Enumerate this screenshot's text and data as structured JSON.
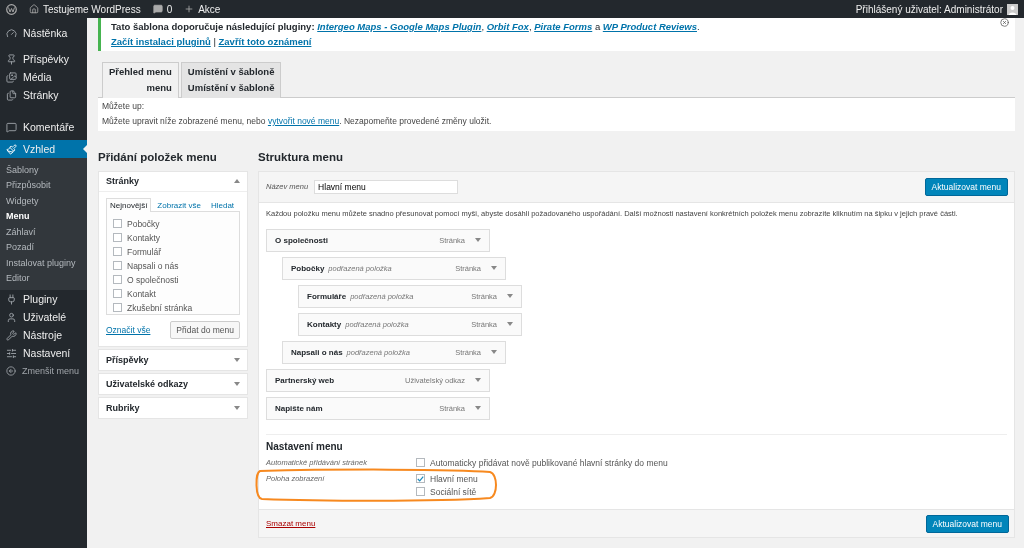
{
  "admin_bar": {
    "site": "Testujeme WordPress",
    "comments": "0",
    "new": "Akce",
    "account": "Přihlášený uživatel: Administrátor"
  },
  "sidebar": {
    "items": [
      {
        "label": "Nástěnka",
        "selected": false
      },
      {
        "label": "Příspěvky",
        "selected": false
      },
      {
        "label": "Média",
        "selected": false
      },
      {
        "label": "Stránky",
        "selected": false
      },
      {
        "label": "Komentáře",
        "selected": false
      },
      {
        "label": "Vzhled",
        "selected": true,
        "children": [
          {
            "label": "Šablony",
            "selected": false
          },
          {
            "label": "Přizpůsobit",
            "selected": false
          },
          {
            "label": "Widgety",
            "selected": false
          },
          {
            "label": "Menu",
            "selected": true
          },
          {
            "label": "Záhlaví",
            "selected": false
          },
          {
            "label": "Pozadí",
            "selected": false
          },
          {
            "label": "Instalovat pluginy",
            "selected": false
          },
          {
            "label": "Editor",
            "selected": false
          }
        ]
      },
      {
        "label": "Pluginy",
        "selected": false
      },
      {
        "label": "Uživatelé",
        "selected": false
      },
      {
        "label": "Nástroje",
        "selected": false
      },
      {
        "label": "Nastavení",
        "selected": false
      }
    ],
    "collapse": "Zmenšit menu"
  },
  "notice": {
    "text": "**Tato šablona doporučuje následující pluginy:**",
    "plugins": [
      {
        "name": "Intergeo Maps - Google Maps Plugin",
        "after": ", "
      },
      {
        "name": "Orbit Fox",
        "after": ", "
      },
      {
        "name": "Pirate Forms",
        "after": " a "
      },
      {
        "name": "WP Product Reviews",
        "after": "."
      }
    ],
    "links": [
      "Začít instalaci pluginů",
      "Zavřít toto oznámení"
    ],
    "separator": "|"
  },
  "tabs": [
    {
      "lines": [
        "Přehled menu",
        "menu"
      ],
      "selected": true
    },
    {
      "lines": [
        "Umístění v šabloně",
        "Umístění v šabloně"
      ],
      "selected": false
    }
  ],
  "info": {
    "ghost": "Můžete up:",
    "before": "Můžete upravit níže zobrazené menu, nebo",
    "link": "vytvořit nové menu",
    "after": ". Nezapomeňte provedené změny uložit."
  },
  "add_items": {
    "title": "Přidání položek menu",
    "sections": [
      {
        "title": "Stránky",
        "expanded": true,
        "tabs": [
          {
            "label": "Nejnovější",
            "selected": true
          },
          {
            "label": "Zobrazit vše",
            "selected": false
          },
          {
            "label": "Hledat",
            "selected": false
          }
        ],
        "pages": [
          {
            "label": "Pobočky",
            "checked": false
          },
          {
            "label": "Kontakty",
            "checked": false
          },
          {
            "label": "Formulář",
            "checked": false
          },
          {
            "label": "Napsali o nás",
            "checked": false
          },
          {
            "label": "O společnosti",
            "checked": false
          },
          {
            "label": "Kontakt",
            "checked": false
          },
          {
            "label": "Zkušební stránka",
            "checked": false
          }
        ],
        "select_all": "Označit vše",
        "add_button": "Přidat do menu"
      },
      {
        "title": "Příspěvky",
        "expanded": false
      },
      {
        "title": "Uživatelské odkazy",
        "expanded": false
      },
      {
        "title": "Rubriky",
        "expanded": false
      }
    ]
  },
  "structure": {
    "title": "Struktura menu",
    "name_label": "Název menu",
    "name_value": "Hlavní menu",
    "save_button": "Aktualizovat menu",
    "description": "Každou položku menu můžete snadno přesunovat pomocí myši, abyste dosáhli požadovaného uspořádání. Další možnosti nastavení konkrétních položek menu zobrazíte kliknutím na šipku v jejich pravé části.",
    "items": [
      {
        "title": "O společnosti",
        "type": "Stránka",
        "children": [
          {
            "title": "Pobočky",
            "note": "podřazená položka",
            "type": "Stránka",
            "children": [
              {
                "title": "Formuláře",
                "note": "podřazená položka",
                "type": "Stránka"
              },
              {
                "title": "Kontakty",
                "note": "podřazená položka",
                "type": "Stránka"
              }
            ]
          },
          {
            "title": "Napsali o nás",
            "note": "podřazená položka",
            "type": "Stránka"
          }
        ]
      },
      {
        "title": "Partnerský web",
        "type": "Uživatelský odkaz"
      },
      {
        "title": "Napište nám",
        "type": "Stránka"
      }
    ],
    "settings": {
      "title": "Nastavení menu",
      "rows": [
        {
          "label": "Automatické přidávání stránek",
          "options": [
            {
              "label": "Automaticky přidávat nově publikované hlavní stránky do menu",
              "checked": false
            }
          ],
          "highlighted": false
        },
        {
          "label": "Poloha zobrazení",
          "options": [
            {
              "label": "Hlavní menu",
              "checked": true
            },
            {
              "label": "Sociální sítě",
              "checked": false
            }
          ],
          "highlighted": true
        }
      ]
    },
    "delete_link": "Smazat menu",
    "save_button_bottom": "Aktualizovat menu"
  }
}
